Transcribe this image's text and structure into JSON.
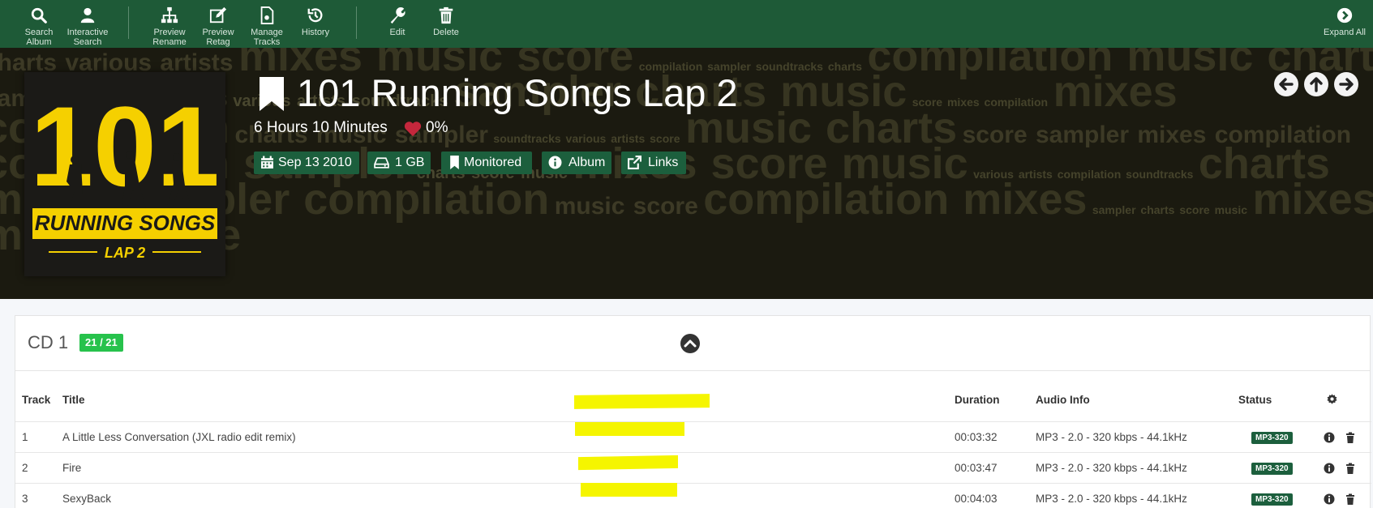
{
  "toolbar": {
    "items": [
      {
        "label1": "Search",
        "label2": "Album",
        "icon": "search-icon"
      },
      {
        "label1": "Interactive",
        "label2": "Search",
        "icon": "user-icon"
      },
      {
        "label1": "Preview",
        "label2": "Rename",
        "icon": "sitemap-icon"
      },
      {
        "label1": "Preview",
        "label2": "Retag",
        "icon": "edit-icon"
      },
      {
        "label1": "Manage",
        "label2": "Tracks",
        "icon": "file-icon"
      },
      {
        "label1": "History",
        "label2": "",
        "icon": "history-icon"
      },
      {
        "label1": "Edit",
        "label2": "",
        "icon": "wrench-icon"
      },
      {
        "label1": "Delete",
        "label2": "",
        "icon": "trash-icon"
      }
    ],
    "expand_all": "Expand All"
  },
  "album": {
    "title": "101 Running Songs Lap 2",
    "runtime": "6 Hours 10 Minutes",
    "rating": "0%",
    "tags": {
      "date": "Sep 13 2010",
      "size": "1 GB",
      "monitored": "Monitored",
      "type": "Album",
      "links": "Links"
    },
    "cover": {
      "number": "101",
      "line1": "RUNNING SONGS",
      "line2": "LAP 2"
    }
  },
  "disc": {
    "title": "CD 1",
    "count": "21 / 21"
  },
  "table": {
    "headers": {
      "track": "Track",
      "title": "Title",
      "duration": "Duration",
      "audio": "Audio Info",
      "status": "Status"
    },
    "rows": [
      {
        "track": "1",
        "title": "A Little Less Conversation (JXL radio edit remix)",
        "duration": "00:03:32",
        "audio": "MP3 - 2.0 - 320 kbps - 44.1kHz",
        "status": "MP3-320"
      },
      {
        "track": "2",
        "title": "Fire",
        "duration": "00:03:47",
        "audio": "MP3 - 2.0 - 320 kbps - 44.1kHz",
        "status": "MP3-320"
      },
      {
        "track": "3",
        "title": "SexyBack",
        "duration": "00:04:03",
        "audio": "MP3 - 2.0 - 320 kbps - 44.1kHz",
        "status": "MP3-320"
      }
    ]
  },
  "colors": {
    "toolbar": "#1e5a37",
    "tag": "#1c5f3d",
    "count_badge": "#27c24c",
    "highlight": "#f5f500"
  }
}
